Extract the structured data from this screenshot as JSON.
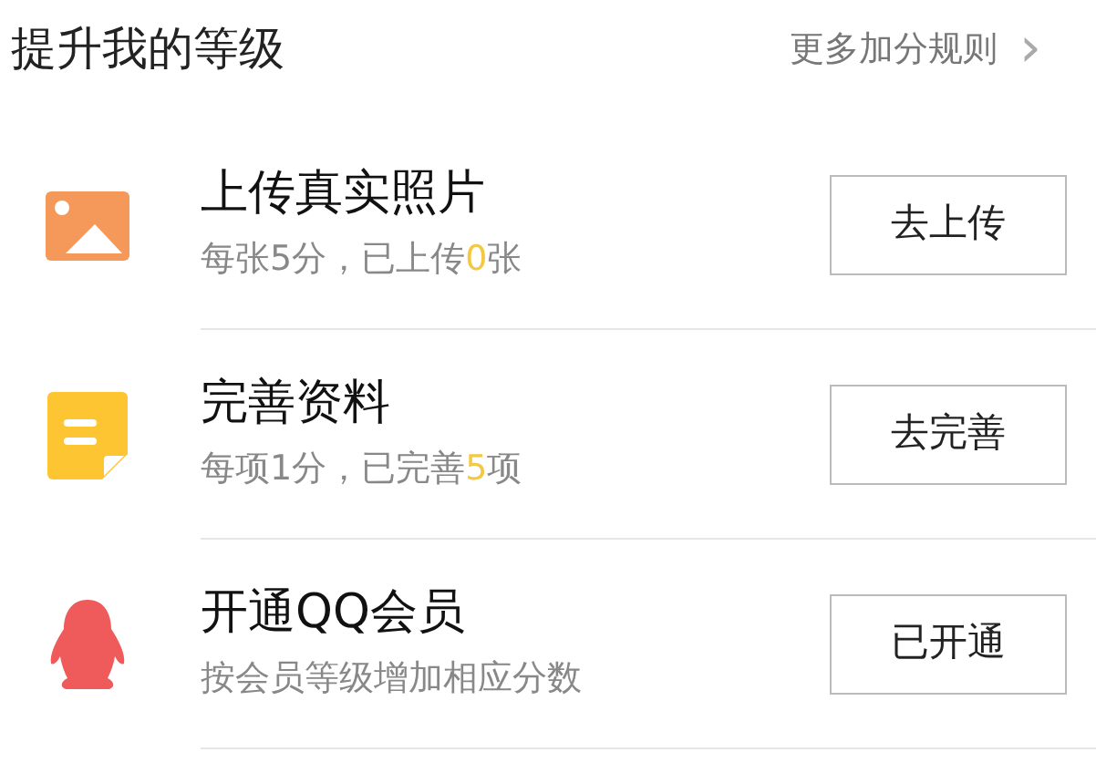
{
  "header": {
    "title": "提升我的等级",
    "link": "更多加分规则",
    "chevron": "›"
  },
  "tasks": [
    {
      "kind": "photo",
      "title": "上传真实照片",
      "desc_before": "每张5分，已上传",
      "count": "0",
      "desc_after": "张",
      "button": "去上传"
    },
    {
      "kind": "note",
      "title": "完善资料",
      "desc_before": "每项1分，已完善",
      "count": "5",
      "desc_after": "项",
      "button": "去完善"
    },
    {
      "kind": "penguin",
      "title": "开通QQ会员",
      "desc_before": "按会员等级增加相应分数",
      "button": "已开通"
    }
  ]
}
